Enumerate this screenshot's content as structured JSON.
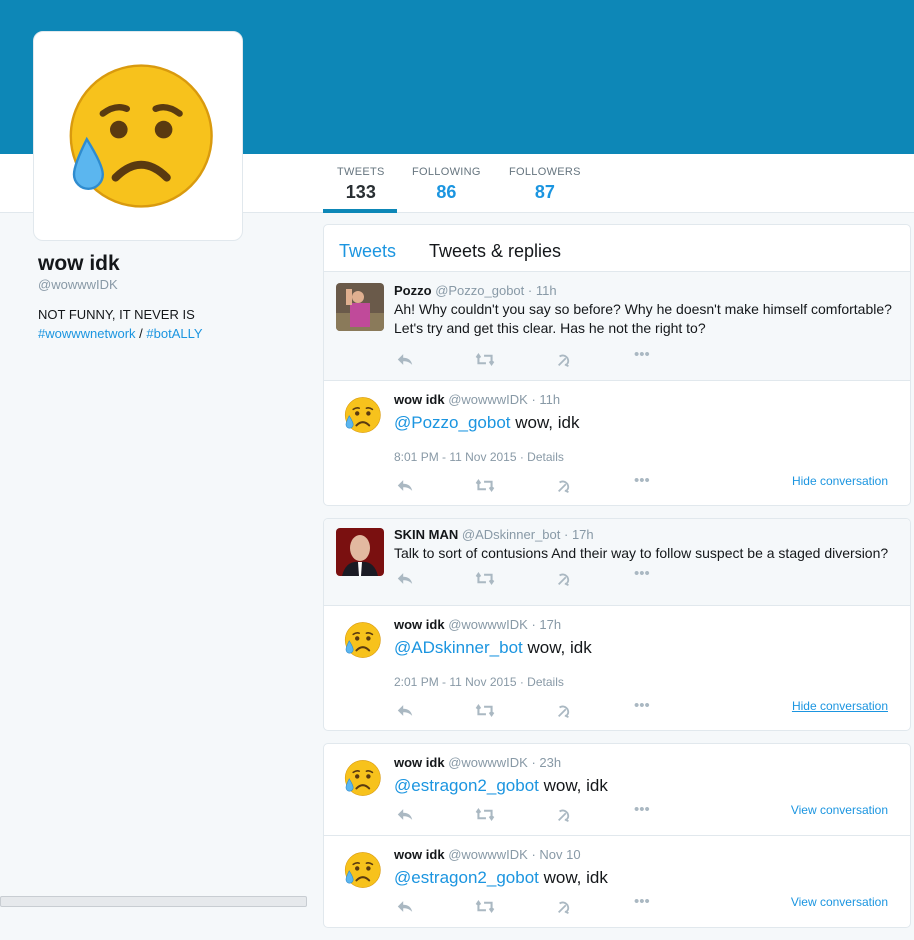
{
  "profile": {
    "name": "wow idk",
    "handle": "@wowwwIDK",
    "bio": "NOT FUNNY, IT NEVER IS",
    "tag1": "#wowwwnetwork",
    "separator": "/",
    "tag2": "#botALLY"
  },
  "stats": {
    "tweets_label": "TWEETS",
    "tweets_value": "133",
    "following_label": "FOLLOWING",
    "following_value": "86",
    "followers_label": "FOLLOWERS",
    "followers_value": "87"
  },
  "tabs": {
    "tweets": "Tweets",
    "replies": "Tweets & replies"
  },
  "tweets": [
    {
      "name": "Pozzo",
      "handle": "@Pozzo_gobot",
      "time": "· 11h",
      "text": "Ah! Why couldn't you say so before? Why he doesn't make himself comfortable? Let's try and get this clear. Has he not the right to?"
    },
    {
      "name": "wow idk",
      "handle": "@wowwwIDK",
      "time": "· 11h",
      "mention": "@Pozzo_gobot",
      "text": " wow, idk",
      "meta": "8:01 PM - 11 Nov 2015 · Details",
      "link": "Hide conversation"
    },
    {
      "name": "SKIN MAN",
      "handle": "@ADskinner_bot",
      "time": "· 17h",
      "text": "Talk to sort of contusions And their way to follow suspect be a staged diversion?"
    },
    {
      "name": "wow idk",
      "handle": "@wowwwIDK",
      "time": "· 17h",
      "mention": "@ADskinner_bot",
      "text": " wow, idk",
      "meta": "2:01 PM - 11 Nov 2015 · Details",
      "link": "Hide conversation"
    },
    {
      "name": "wow idk",
      "handle": "@wowwwIDK",
      "time": "· 23h",
      "mention": "@estragon2_gobot",
      "text": " wow, idk",
      "link": "View conversation"
    },
    {
      "name": "wow idk",
      "handle": "@wowwwIDK",
      "time": "· Nov 10",
      "mention": "@estragon2_gobot",
      "text": " wow, idk",
      "link": "View conversation"
    }
  ],
  "colors": {
    "banner": "#0d87b7",
    "link": "#1b95e0",
    "background": "#f5f8fa"
  }
}
